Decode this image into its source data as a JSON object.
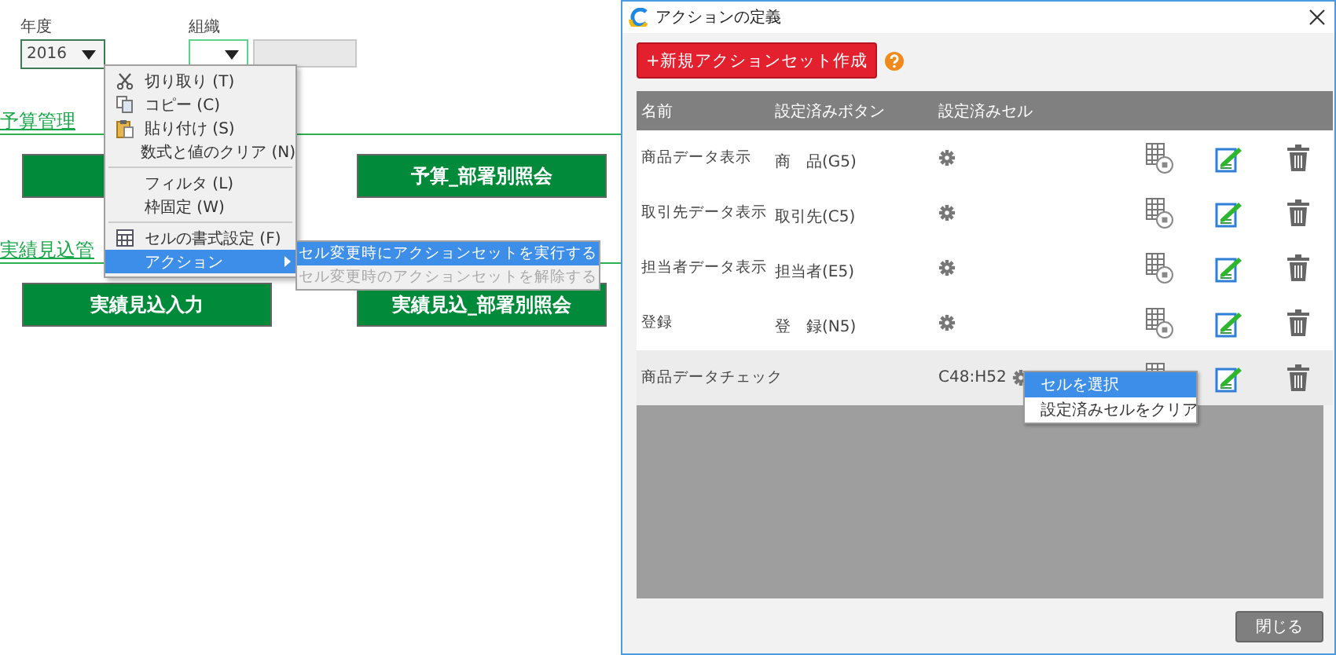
{
  "sheet": {
    "filters": [
      {
        "label": "年度",
        "value": "2016"
      },
      {
        "label": "組織"
      }
    ],
    "sections": [
      {
        "title": "予算管理",
        "buttons": [
          {
            "kind": "blank"
          },
          {
            "kind": "labeled",
            "label": "予算_部署別照会"
          }
        ]
      },
      {
        "title": "実績見込管",
        "buttons": [
          {
            "kind": "labeled",
            "label": "実績見込入力"
          },
          {
            "kind": "labeled",
            "label": "実績見込_部署別照会"
          }
        ]
      }
    ],
    "context_menu": {
      "groups": [
        [
          {
            "kind": "cut",
            "label": "切り取り (T)",
            "selected": false
          },
          {
            "kind": "copy",
            "label": "コピー (C)",
            "selected": false
          },
          {
            "kind": "paste",
            "label": "貼り付け (S)",
            "selected": false
          },
          {
            "kind": "plain",
            "label": "数式と値のクリア (N)",
            "selected": false
          }
        ],
        [
          {
            "kind": "plain",
            "label": "フィルタ (L)",
            "selected": false
          },
          {
            "kind": "plain",
            "label": "枠固定 (W)",
            "selected": false
          }
        ],
        [
          {
            "kind": "format",
            "label": "セルの書式設定 (F)",
            "selected": false
          },
          {
            "kind": "submenu",
            "label": "アクション",
            "selected": true
          }
        ]
      ],
      "submenu": [
        {
          "label": "セル変更時にアクションセットを実行する",
          "selected": true,
          "disabled": false
        },
        {
          "label": "セル変更時のアクションセットを解除する",
          "selected": false,
          "disabled": true
        }
      ]
    }
  },
  "dialog": {
    "title": "アクションの定義",
    "new_button": "+新規アクションセット作成",
    "columns": [
      "名前",
      "設定済みボタン",
      "設定済みセル"
    ],
    "rows": [
      {
        "name": "商品データ表示",
        "button": "商　品(G5)",
        "selected": false
      },
      {
        "name": "取引先データ表示",
        "button": "取引先(C5)",
        "selected": false
      },
      {
        "name": "担当者データ表示",
        "button": "担当者(E5)",
        "selected": false
      },
      {
        "name": "登録",
        "button": "登　録(N5)",
        "selected": false
      },
      {
        "name": "商品データチェック",
        "cell": "C48:H52",
        "selected": true
      }
    ],
    "popup": [
      {
        "label": "セルを選択",
        "selected": true
      },
      {
        "label": "設定済みセルをクリア",
        "selected": false
      }
    ],
    "close_button": "閉じる"
  }
}
